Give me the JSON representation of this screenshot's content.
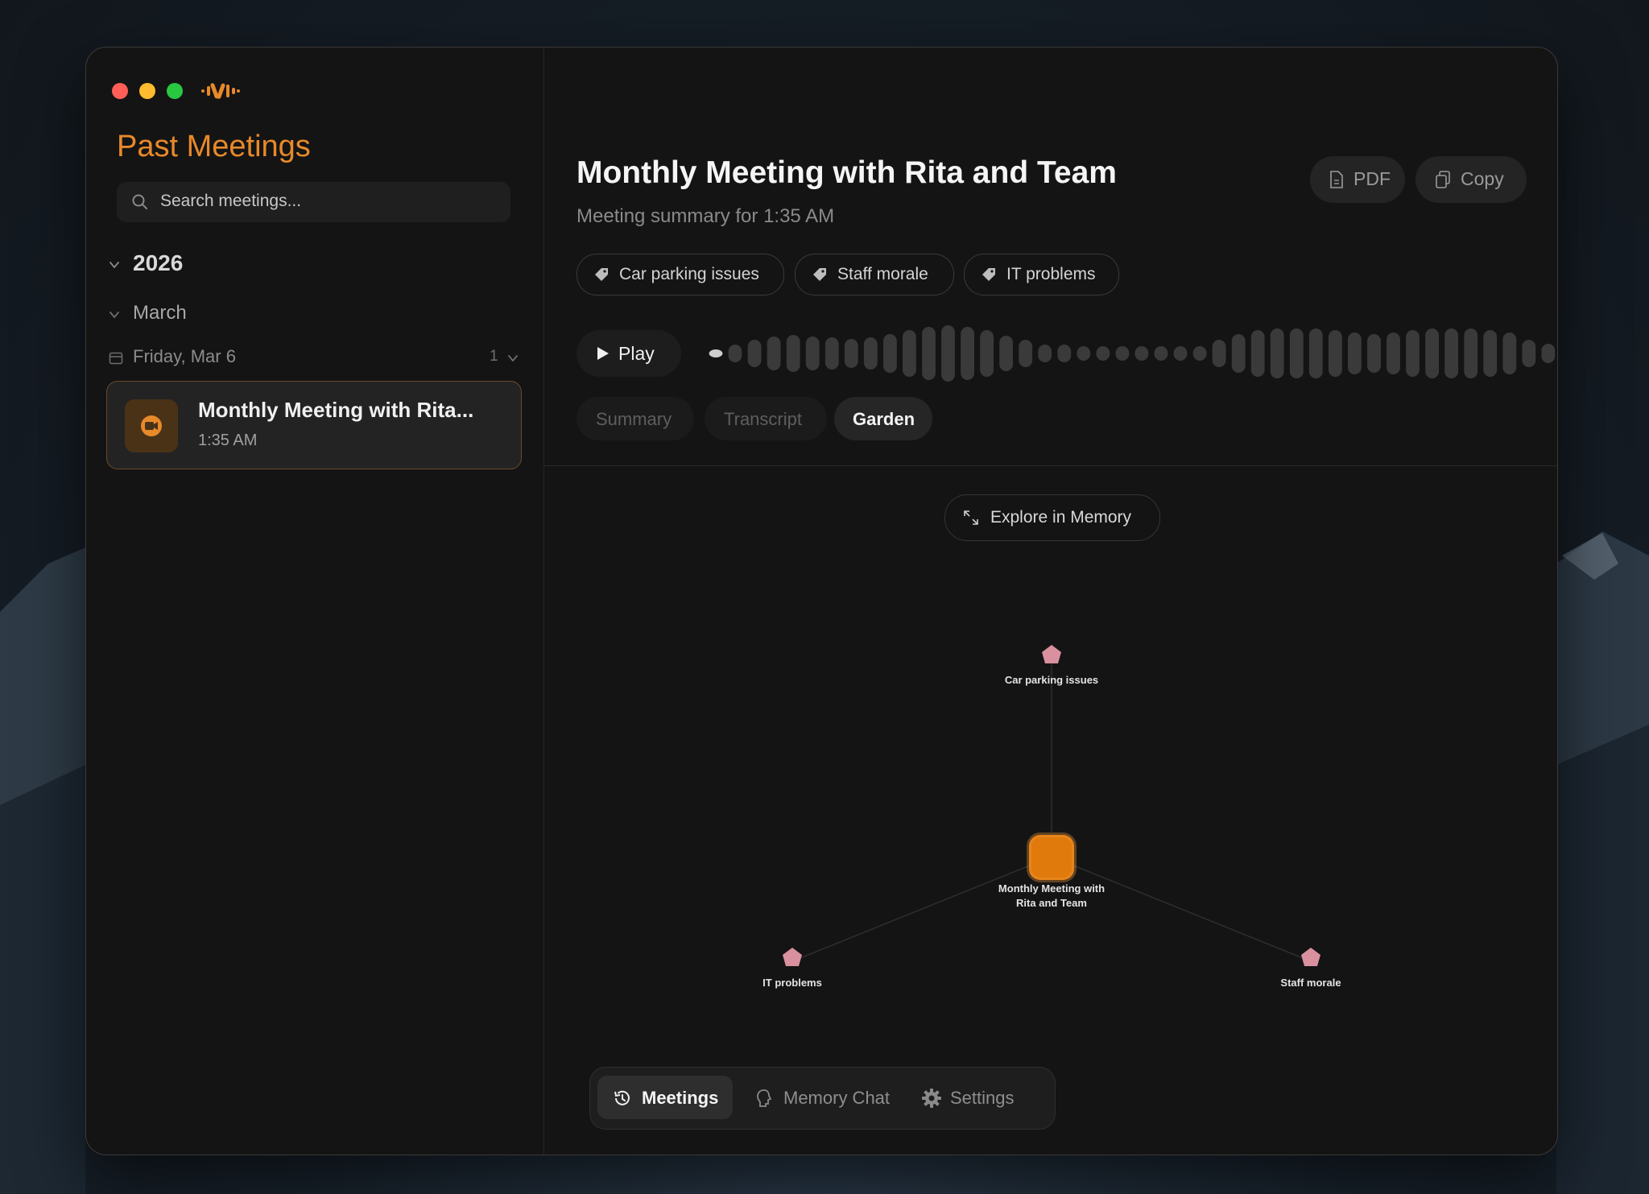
{
  "app": {
    "traffic_lights": {
      "close": "#ff5f57",
      "minimize": "#febc2e",
      "zoom": "#28c840"
    },
    "logo_icon": "waveform-logo-icon",
    "accent": "#e8892a"
  },
  "sidebar": {
    "title": "Past Meetings",
    "search_placeholder": "Search meetings...",
    "year": "2026",
    "month": "March",
    "day": "Friday, Mar 6",
    "day_count": "1",
    "meetings": [
      {
        "title": "Monthly Meeting with Rita...",
        "time": "1:35 AM",
        "icon": "video-camera-icon"
      }
    ]
  },
  "main": {
    "title": "Monthly Meeting with Rita and Team",
    "subtitle": "Meeting summary for 1:35 AM",
    "actions": {
      "pdf": "PDF",
      "copy": "Copy"
    },
    "tags": [
      "Car parking issues",
      "Staff morale",
      "IT problems"
    ],
    "player": {
      "play_label": "Play",
      "progress": 0.0
    },
    "tabs": [
      {
        "label": "Summary",
        "active": false
      },
      {
        "label": "Transcript",
        "active": false
      },
      {
        "label": "Garden",
        "active": true
      }
    ],
    "explore_label": "Explore in Memory"
  },
  "graph": {
    "center": {
      "label_line1": "Monthly Meeting with",
      "label_line2": "Rita and Team",
      "color": "#e07a0c"
    },
    "topics": [
      {
        "label": "Car parking issues",
        "color": "#d9909f"
      },
      {
        "label": "IT problems",
        "color": "#d9909f"
      },
      {
        "label": "Staff morale",
        "color": "#d9909f"
      }
    ]
  },
  "bottom_nav": [
    {
      "label": "Meetings",
      "icon": "history-icon",
      "active": true
    },
    {
      "label": "Memory Chat",
      "icon": "brain-icon",
      "active": false
    },
    {
      "label": "Settings",
      "icon": "gear-icon",
      "active": false
    }
  ]
}
